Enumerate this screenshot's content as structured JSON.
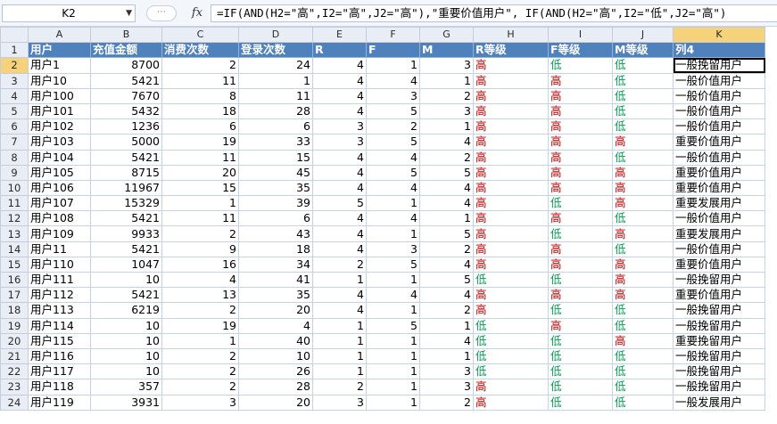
{
  "formula_bar": {
    "cell_ref": "K2",
    "fx_label": "fx",
    "dots_label": "⋯",
    "formula": "=IF(AND(H2=\"高\",I2=\"高\",J2=\"高\"),\"重要价值用户\", IF(AND(H2=\"高\",I2=\"低\",J2=\"高\")"
  },
  "columns": [
    "A",
    "B",
    "C",
    "D",
    "E",
    "F",
    "G",
    "H",
    "I",
    "J",
    "K"
  ],
  "header_row": {
    "row_num": "1",
    "cells": [
      "用户",
      "充值金额",
      "消费次数",
      "登录次数",
      "R",
      "F",
      "M",
      "R等级",
      "F等级",
      "M等级",
      "列4"
    ]
  },
  "rows": [
    {
      "n": "2",
      "c": [
        "用户1",
        "8700",
        "2",
        "24",
        "4",
        "1",
        "3",
        "高",
        "低",
        "低",
        "一般挽留用户"
      ]
    },
    {
      "n": "3",
      "c": [
        "用户10",
        "5421",
        "11",
        "1",
        "4",
        "4",
        "1",
        "高",
        "高",
        "低",
        "一般价值用户"
      ]
    },
    {
      "n": "4",
      "c": [
        "用户100",
        "7670",
        "8",
        "11",
        "4",
        "3",
        "2",
        "高",
        "高",
        "低",
        "一般价值用户"
      ]
    },
    {
      "n": "5",
      "c": [
        "用户101",
        "5432",
        "18",
        "28",
        "4",
        "5",
        "3",
        "高",
        "高",
        "低",
        "一般价值用户"
      ]
    },
    {
      "n": "6",
      "c": [
        "用户102",
        "1236",
        "6",
        "6",
        "3",
        "2",
        "1",
        "高",
        "高",
        "低",
        "一般价值用户"
      ]
    },
    {
      "n": "7",
      "c": [
        "用户103",
        "5000",
        "19",
        "33",
        "3",
        "5",
        "4",
        "高",
        "高",
        "高",
        "重要价值用户"
      ]
    },
    {
      "n": "8",
      "c": [
        "用户104",
        "5421",
        "11",
        "15",
        "4",
        "4",
        "2",
        "高",
        "高",
        "低",
        "一般价值用户"
      ]
    },
    {
      "n": "9",
      "c": [
        "用户105",
        "8715",
        "20",
        "45",
        "4",
        "5",
        "5",
        "高",
        "高",
        "高",
        "重要价值用户"
      ]
    },
    {
      "n": "10",
      "c": [
        "用户106",
        "11967",
        "15",
        "35",
        "4",
        "4",
        "4",
        "高",
        "高",
        "高",
        "重要价值用户"
      ]
    },
    {
      "n": "11",
      "c": [
        "用户107",
        "15329",
        "1",
        "39",
        "5",
        "1",
        "4",
        "高",
        "低",
        "高",
        "重要发展用户"
      ]
    },
    {
      "n": "12",
      "c": [
        "用户108",
        "5421",
        "11",
        "6",
        "4",
        "4",
        "1",
        "高",
        "高",
        "低",
        "一般价值用户"
      ]
    },
    {
      "n": "13",
      "c": [
        "用户109",
        "9933",
        "2",
        "43",
        "4",
        "1",
        "5",
        "高",
        "低",
        "高",
        "重要发展用户"
      ]
    },
    {
      "n": "14",
      "c": [
        "用户11",
        "5421",
        "9",
        "18",
        "4",
        "3",
        "2",
        "高",
        "高",
        "低",
        "一般价值用户"
      ]
    },
    {
      "n": "15",
      "c": [
        "用户110",
        "1047",
        "16",
        "34",
        "2",
        "5",
        "4",
        "高",
        "高",
        "高",
        "重要价值用户"
      ]
    },
    {
      "n": "16",
      "c": [
        "用户111",
        "10",
        "4",
        "41",
        "1",
        "1",
        "5",
        "低",
        "低",
        "高",
        "一般挽留用户"
      ]
    },
    {
      "n": "17",
      "c": [
        "用户112",
        "5421",
        "13",
        "35",
        "4",
        "4",
        "4",
        "高",
        "高",
        "高",
        "重要价值用户"
      ]
    },
    {
      "n": "18",
      "c": [
        "用户113",
        "6219",
        "2",
        "20",
        "4",
        "1",
        "2",
        "高",
        "低",
        "低",
        "一般挽留用户"
      ]
    },
    {
      "n": "19",
      "c": [
        "用户114",
        "10",
        "19",
        "4",
        "1",
        "5",
        "1",
        "低",
        "高",
        "低",
        "一般挽留用户"
      ]
    },
    {
      "n": "20",
      "c": [
        "用户115",
        "10",
        "1",
        "40",
        "1",
        "1",
        "4",
        "低",
        "低",
        "高",
        "重要挽留用户"
      ]
    },
    {
      "n": "21",
      "c": [
        "用户116",
        "10",
        "2",
        "10",
        "1",
        "1",
        "1",
        "低",
        "低",
        "低",
        "一般挽留用户"
      ]
    },
    {
      "n": "22",
      "c": [
        "用户117",
        "10",
        "2",
        "26",
        "1",
        "1",
        "3",
        "低",
        "低",
        "低",
        "一般挽留用户"
      ]
    },
    {
      "n": "23",
      "c": [
        "用户118",
        "357",
        "2",
        "28",
        "2",
        "1",
        "3",
        "高",
        "低",
        "低",
        "一般挽留用户"
      ]
    },
    {
      "n": "24",
      "c": [
        "用户119",
        "3931",
        "3",
        "20",
        "3",
        "1",
        "2",
        "高",
        "低",
        "低",
        "一般发展用户"
      ]
    }
  ]
}
